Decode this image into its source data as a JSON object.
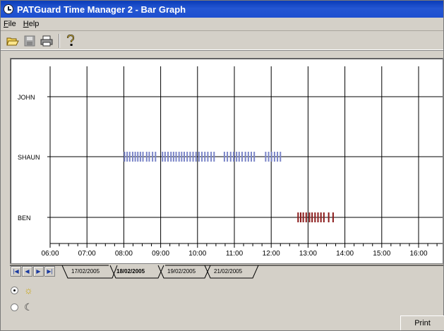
{
  "window": {
    "title": "PATGuard Time Manager 2  - Bar Graph"
  },
  "menu": {
    "file": {
      "accel": "F",
      "rest": "ile"
    },
    "help": {
      "accel": "H",
      "rest": "elp"
    }
  },
  "toolbar": {
    "icons": [
      "open-folder-icon",
      "save-icon",
      "print-icon",
      "help-icon"
    ]
  },
  "chart_data": {
    "type": "timeline-bar",
    "categories": [
      "JOHN",
      "SHAUN",
      "BEN"
    ],
    "x_ticks": [
      "06:00",
      "07:00",
      "08:00",
      "09:00",
      "10:00",
      "11:00",
      "12:00",
      "13:00",
      "14:00",
      "15:00",
      "16:00"
    ],
    "xlim_hours": [
      6,
      16.7
    ],
    "grid": true,
    "series": [
      {
        "category": "SHAUN",
        "color": "#7b86c8",
        "events_hours": [
          8.02,
          8.09,
          8.16,
          8.24,
          8.31,
          8.38,
          8.45,
          8.52,
          8.62,
          8.69,
          8.78,
          8.86,
          9.05,
          9.12,
          9.2,
          9.28,
          9.35,
          9.42,
          9.5,
          9.57,
          9.64,
          9.72,
          9.8,
          9.88,
          9.96,
          10.04,
          10.12,
          10.2,
          10.28,
          10.37,
          10.45,
          10.73,
          10.81,
          10.9,
          10.98,
          11.06,
          11.13,
          11.21,
          11.3,
          11.38,
          11.46,
          11.54,
          11.85,
          11.93,
          12.01,
          12.09,
          12.17,
          12.25
        ]
      },
      {
        "category": "BEN",
        "color": "#8b1a1a",
        "events_hours": [
          12.73,
          12.8,
          12.87,
          12.95,
          13.04,
          13.11,
          13.19,
          13.27,
          13.35,
          13.43,
          13.56,
          13.68
        ]
      }
    ]
  },
  "tabs": {
    "nav_buttons": [
      "|◀",
      "◀",
      "▶",
      "▶|"
    ],
    "dates": [
      "17/02/2005",
      "18/02/2005",
      "19/02/2005",
      "21/02/2005"
    ],
    "active_index": 1
  },
  "shift_options": [
    {
      "icon": "sun-icon",
      "glyph": "☼",
      "checked": true
    },
    {
      "icon": "moon-icon",
      "glyph": "☾",
      "checked": false
    }
  ],
  "buttons": {
    "print": "Print"
  }
}
